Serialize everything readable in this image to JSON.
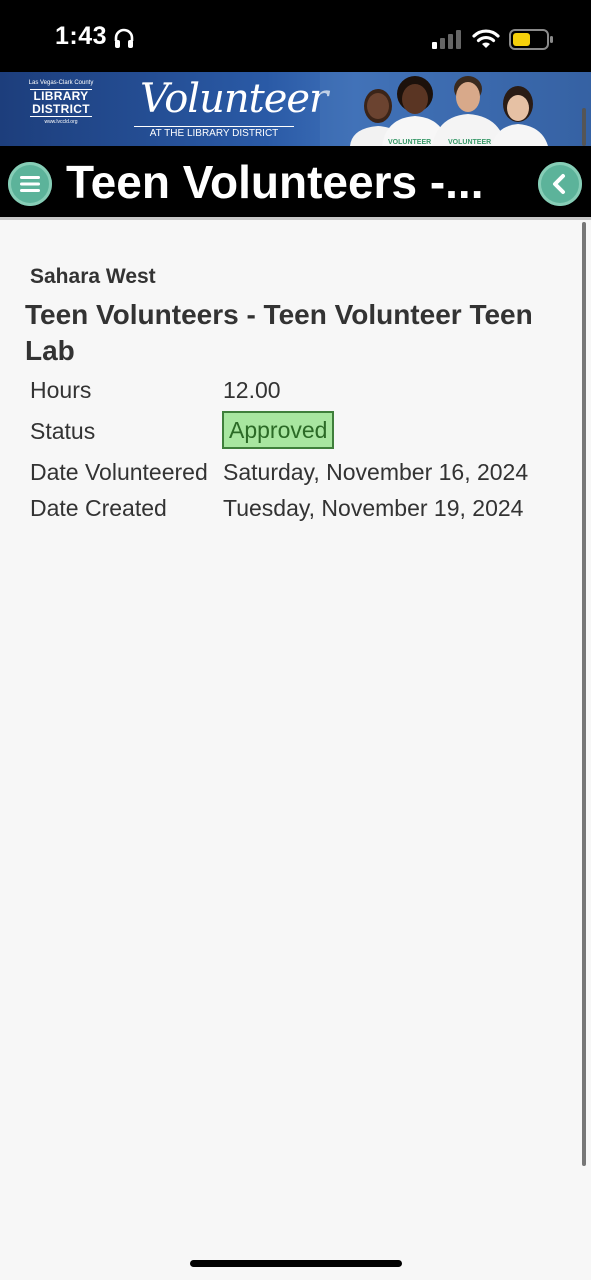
{
  "status_bar": {
    "time": "1:43"
  },
  "banner": {
    "library_top": "Las Vegas-Clark County",
    "library_name_1": "LIBRARY",
    "library_name_2": "DISTRICT",
    "library_url": "www.lvccld.org",
    "volunteer_word": "Volunteer",
    "volunteer_sub": "AT THE LIBRARY DISTRICT"
  },
  "header": {
    "title": "Teen Volunteers -..."
  },
  "record": {
    "branch": "Sahara West",
    "opportunity": "Teen Volunteers - Teen Volunteer Teen Lab",
    "hours_label": "Hours",
    "hours_value": "12.00",
    "status_label": "Status",
    "status_value": "Approved",
    "date_volunteered_label": "Date Volunteered",
    "date_volunteered_value": "Saturday, November 16, 2024",
    "date_created_label": "Date Created",
    "date_created_value": "Tuesday, November 19, 2024"
  },
  "colors": {
    "accent_button": "#5cb39a",
    "status_approved_bg": "#a8e6a0",
    "status_approved_border": "#3f7f3b"
  },
  "icons": {
    "menu": "hamburger-menu-icon",
    "back": "chevron-left-icon"
  }
}
